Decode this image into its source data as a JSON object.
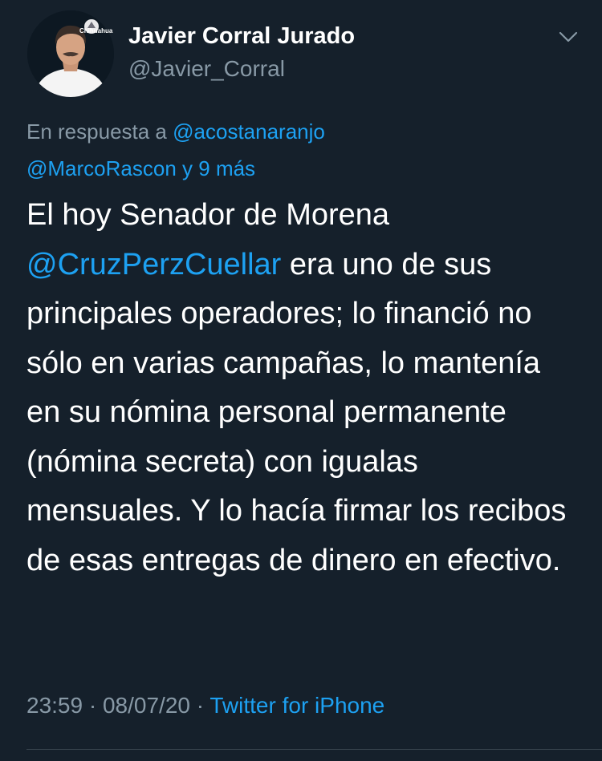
{
  "author": {
    "display_name": "Javier Corral Jurado",
    "handle": "@Javier_Corral",
    "avatar_badge": "Chihuahua"
  },
  "reply": {
    "prefix": "En respuesta a",
    "mention_1": "@acostanaranjo",
    "mention_2": "@MarcoRascon",
    "suffix": "y 9 más"
  },
  "tweet": {
    "text_1": "El hoy Senador de Morena",
    "mention": "@CruzPerzCuellar",
    "text_2": "era uno de sus principales operadores; lo financió no sólo en varias campañas, lo mantenía en su nómina personal permanente (nómina secreta) con igualas mensuales. Y lo hacía firmar los recibos de esas entregas de dinero en efectivo."
  },
  "meta": {
    "time": "23:59",
    "sep_1": "·",
    "date": "08/07/20",
    "sep_2": "·",
    "source": "Twitter for iPhone"
  },
  "colors": {
    "background": "#15202b",
    "text": "#ffffff",
    "muted": "#8899a6",
    "link": "#1da1f2",
    "divider": "#38444d"
  },
  "icons": {
    "menu": "chevron-down-icon"
  }
}
